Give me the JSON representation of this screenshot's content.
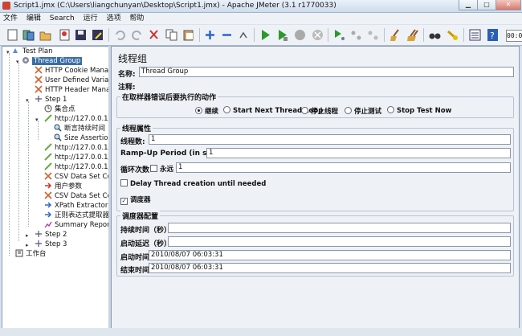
{
  "window": {
    "title": "Script1.jmx (C:\\Users\\liangchunyan\\Desktop\\Script1.jmx) - Apache JMeter (3.1 r1770033)"
  },
  "menu": [
    "文件",
    "编辑",
    "Search",
    "运行",
    "选项",
    "帮助"
  ],
  "toolbar": {
    "timer": "00:00"
  },
  "tree": {
    "items": [
      {
        "label": "Test Plan",
        "icon": "test-plan-icon"
      },
      {
        "label": "Thread Group",
        "icon": "gear-icon"
      },
      {
        "label": "HTTP Cookie Manager",
        "icon": "wrench-icon"
      },
      {
        "label": "User Defined Variables",
        "icon": "wrench-icon"
      },
      {
        "label": "HTTP Header Manager",
        "icon": "wrench-icon"
      },
      {
        "label": "Step 1",
        "icon": "controller-icon"
      },
      {
        "label": "集合点",
        "icon": "timer-icon"
      },
      {
        "label": "http://127.0.0.1/jforum",
        "icon": "sampler-icon"
      },
      {
        "label": "断言持续时间",
        "icon": "magnifier-icon"
      },
      {
        "label": "Size Assertion",
        "icon": "magnifier-icon"
      },
      {
        "label": "http://127.0.0.1/jforum",
        "icon": "sampler-icon"
      },
      {
        "label": "http://127.0.0.1/jforum",
        "icon": "sampler-icon"
      },
      {
        "label": "http://127.0.0.1/jforum",
        "icon": "sampler-icon"
      },
      {
        "label": "CSV Data Set Config",
        "icon": "wrench-icon"
      },
      {
        "label": "用户参数",
        "icon": "arrow-icon"
      },
      {
        "label": "CSV Data Set Config",
        "icon": "wrench-icon"
      },
      {
        "label": "XPath Extractor",
        "icon": "arrow-icon"
      },
      {
        "label": "正则表达式提取器",
        "icon": "arrow-icon"
      },
      {
        "label": "Summary Report",
        "icon": "report-icon"
      },
      {
        "label": "Step 2",
        "icon": "controller-icon"
      },
      {
        "label": "Step 3",
        "icon": "controller-icon"
      },
      {
        "label": "工作台",
        "icon": "workbench-icon"
      }
    ]
  },
  "panel": {
    "heading": "线程组",
    "name_label": "名称:",
    "name_value": "Thread Group",
    "comment_label": "注释:",
    "comment_value": "",
    "error_group": {
      "title": "在取样器错误后要执行的动作",
      "options": [
        "继续",
        "Start Next Thread Loop",
        "停止线程",
        "停止测试",
        "Stop Test Now"
      ],
      "selected": "继续"
    },
    "thread_props": {
      "title": "线程属性",
      "threads_label": "线程数:",
      "threads_value": "1",
      "rampup_label": "Ramp-Up Period (in seconds):",
      "rampup_value": "1",
      "loop_label": "循环次数",
      "forever_label": "永远",
      "forever_checked": false,
      "loop_value": "1",
      "delay_label": "Delay Thread creation until needed",
      "delay_checked": false,
      "scheduler_label": "调度器",
      "scheduler_checked": true
    },
    "scheduler": {
      "title": "调度器配置",
      "duration_label": "持续时间（秒）",
      "duration_value": "",
      "delay_label": "启动延迟（秒）",
      "delay_value": "",
      "start_label": "启动时间",
      "start_value": "2010/08/07 06:03:31",
      "end_label": "结束时间",
      "end_value": "2010/08/07 06:03:31"
    }
  }
}
